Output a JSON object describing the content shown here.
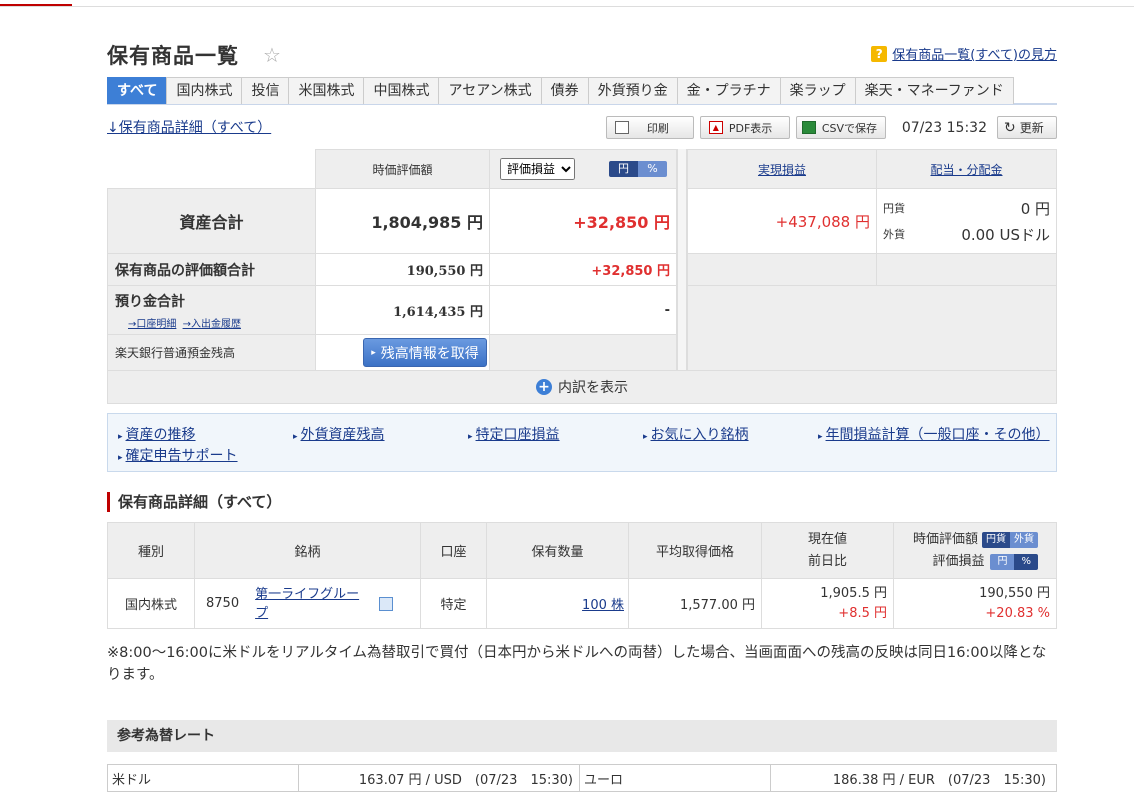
{
  "page": {
    "title": "保有商品一覧",
    "help_link": "保有商品一覧(すべて)の見方",
    "detail_link": "↓保有商品詳細（すべて）"
  },
  "tabs": [
    "すべて",
    "国内株式",
    "投信",
    "米国株式",
    "中国株式",
    "アセアン株式",
    "債券",
    "外貨預り金",
    "金・プラチナ",
    "楽ラップ",
    "楽天・マネーファンド"
  ],
  "toolbar": {
    "print": "印刷",
    "pdf": "PDF表示",
    "csv": "CSVで保存",
    "time": "07/23 15:32",
    "refresh": "更新"
  },
  "summary": {
    "col_market_value": "時価評価額",
    "select_value": "評価損益",
    "unit_yen": "円",
    "unit_pct": "%",
    "col_realized": "実現損益",
    "col_dividend": "配当・分配金",
    "total_label": "資産合計",
    "total_value": "1,804,985 円",
    "total_pl": "+32,850 円",
    "realized_value": "+437,088 円",
    "div_yen_label": "円貨",
    "div_yen_value": "0 円",
    "div_fx_label": "外貨",
    "div_fx_value": "0.00 USドル",
    "holdings_label": "保有商品の評価額合計",
    "holdings_value": "190,550 円",
    "holdings_pl": "+32,850 円",
    "deposit_label": "預り金合計",
    "deposit_link1": "→口座明細",
    "deposit_link2": "→入出金履歴",
    "deposit_value": "1,614,435 円",
    "deposit_pl": "-",
    "bank_label": "楽天銀行普通預金残高",
    "bank_button": "残高情報を取得",
    "expand": "内訳を表示"
  },
  "links": [
    "資産の推移",
    "外貨資産残高",
    "特定口座損益",
    "お気に入り銘柄",
    "年間損益計算（一般口座・その他）",
    "確定申告サポート"
  ],
  "holdings": {
    "section_title": "保有商品詳細（すべて）",
    "headers": {
      "type": "種別",
      "name": "銘柄",
      "account": "口座",
      "qty": "保有数量",
      "avg": "平均取得価格",
      "price1": "現在値",
      "price2": "前日比",
      "mv": "時価評価額",
      "pl": "評価損益",
      "yen": "円貨",
      "fx": "外貨",
      "y2": "円",
      "pct": "%"
    },
    "rows": [
      {
        "type": "国内株式",
        "code": "8750",
        "name": "第一ライフグループ",
        "account": "特定",
        "qty": "100 株",
        "avg": "1,577.00 円",
        "price": "1,905.5 円",
        "change": "+8.5 円",
        "mv": "190,550 円",
        "pl_pct": "+20.83 %"
      }
    ]
  },
  "note": "※8:00～16:00に米ドルをリアルタイム為替取引で買付（日本円から米ドルへの両替）した場合、当画面面への残高の反映は同日16:00以降となります。",
  "rates": {
    "title": "参考為替レート",
    "usd_label": "米ドル",
    "usd_value": "163.07 円 / USD　(07/23　15:30)",
    "eur_label": "ユーロ",
    "eur_value": "186.38 円 / EUR　(07/23　15:30)"
  },
  "colors": {
    "accent": "#3d7fd6",
    "positive": "#e03030",
    "brand": "#bf0000"
  }
}
